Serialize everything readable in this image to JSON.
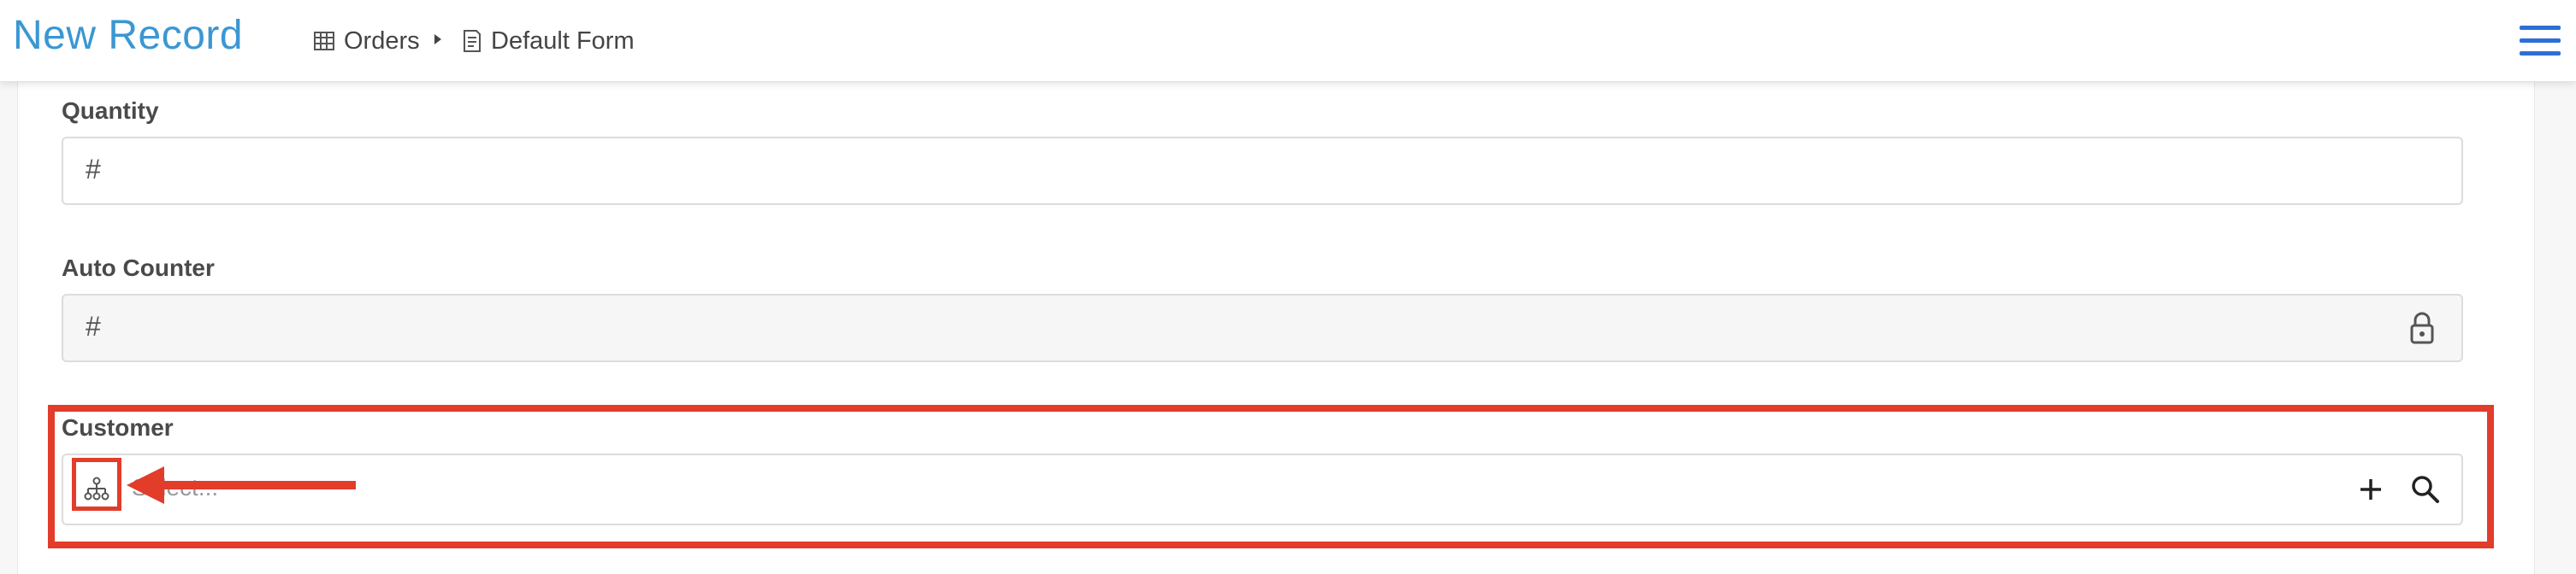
{
  "header": {
    "title": "New Record",
    "breadcrumb": [
      {
        "label": "Orders",
        "icon": "table-icon"
      },
      {
        "label": "Default Form",
        "icon": "form-icon"
      }
    ],
    "menu_icon": "hamburger-menu-icon",
    "title_color": "#3b97d3"
  },
  "form": {
    "fields": [
      {
        "label": "Quantity",
        "prefix": "#",
        "value": ""
      },
      {
        "label": "Auto Counter",
        "prefix": "#",
        "value": "",
        "locked": true
      },
      {
        "label": "Customer",
        "placeholder": "Select...",
        "icons": [
          "hierarchy-tree-icon",
          "plus-icon",
          "search-icon"
        ]
      }
    ]
  },
  "annotation": {
    "highlight_color": "#e23c2a"
  }
}
